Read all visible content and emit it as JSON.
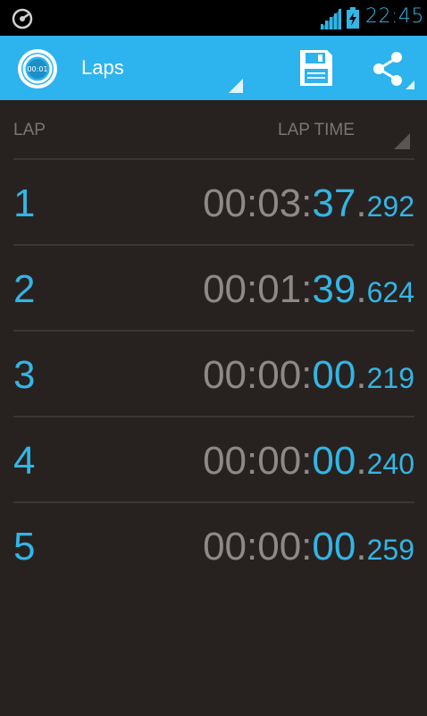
{
  "status_bar": {
    "time": "22:45",
    "icons": [
      "stopwatch-notification-icon",
      "signal-icon",
      "battery-charging-icon"
    ]
  },
  "action_bar": {
    "logo_text": "00:01",
    "spinner_title": "Laps",
    "actions": [
      "save-icon",
      "share-icon"
    ]
  },
  "header": {
    "lap": "LAP",
    "lap_time": "LAP TIME"
  },
  "laps": [
    {
      "number": "1",
      "hm": "00:03:",
      "sec": "37",
      "dot": ".",
      "ms": "292"
    },
    {
      "number": "2",
      "hm": "00:01:",
      "sec": "39",
      "dot": ".",
      "ms": "624"
    },
    {
      "number": "3",
      "hm": "00:00:",
      "sec": "00",
      "dot": ".",
      "ms": "219"
    },
    {
      "number": "4",
      "hm": "00:00:",
      "sec": "00",
      "dot": ".",
      "ms": "240"
    },
    {
      "number": "5",
      "hm": "00:00:",
      "sec": "00",
      "dot": ".",
      "ms": "259"
    }
  ],
  "colors": {
    "accent": "#33b5e5",
    "action_bar": "#2db3ee",
    "background": "#272220",
    "muted_text": "#8e8986"
  }
}
